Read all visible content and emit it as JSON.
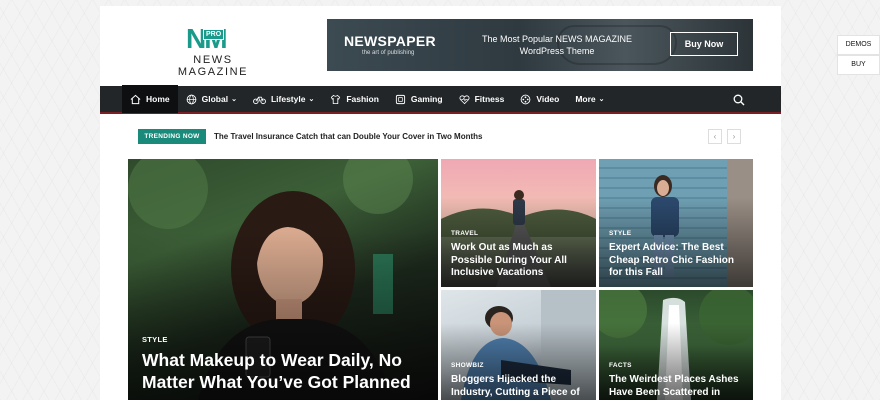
{
  "header": {
    "logo_mark": "NM",
    "logo_badge": "PRO",
    "logo_text": "NEWS MAGAZINE"
  },
  "banner": {
    "title": "NEWSPAPER",
    "subtitle": "the art of publishing",
    "tagline_line1": "The Most Popular NEWS MAGAZINE",
    "tagline_line2": "WordPress Theme",
    "button": "Buy Now"
  },
  "side_buttons": {
    "demos": "DEMOS",
    "buy": "BUY"
  },
  "nav": {
    "items": [
      {
        "label": "Home",
        "icon": "home-icon"
      },
      {
        "label": "Global",
        "icon": "globe-icon",
        "dropdown": true
      },
      {
        "label": "Lifestyle",
        "icon": "bicycle-icon",
        "dropdown": true
      },
      {
        "label": "Fashion",
        "icon": "fashion-icon"
      },
      {
        "label": "Gaming",
        "icon": "gaming-icon"
      },
      {
        "label": "Fitness",
        "icon": "heart-pulse-icon"
      },
      {
        "label": "Video",
        "icon": "film-icon"
      },
      {
        "label": "More",
        "icon": "",
        "dropdown": true
      }
    ],
    "dropdown_glyph": "⌄",
    "search_icon": "search-icon"
  },
  "trending": {
    "badge": "TRENDING NOW",
    "headline": "The Travel Insurance Catch that can Double Your Cover in Two Months",
    "prev": "‹",
    "next": "›"
  },
  "featured": {
    "category": "STYLE",
    "title_line1": "What Makeup to Wear Daily, No",
    "title_line2": "Matter What You’ve Got Planned"
  },
  "cards": [
    {
      "category": "TRAVEL",
      "title": "Work Out as Much as Possible During Your All Inclusive Vacations"
    },
    {
      "category": "STYLE",
      "title": "Expert Advice: The Best Cheap Retro Chic Fashion for this Fall"
    },
    {
      "category": "SHOWBIZ",
      "title": "Bloggers Hijacked the Industry, Cutting a Piece of"
    },
    {
      "category": "FACTS",
      "title": "The Weirdest Places Ashes Have Been Scattered in"
    }
  ],
  "colors": {
    "accent": "#1a8a7a",
    "nav_bg": "#222628",
    "nav_border": "#7a1f24"
  }
}
